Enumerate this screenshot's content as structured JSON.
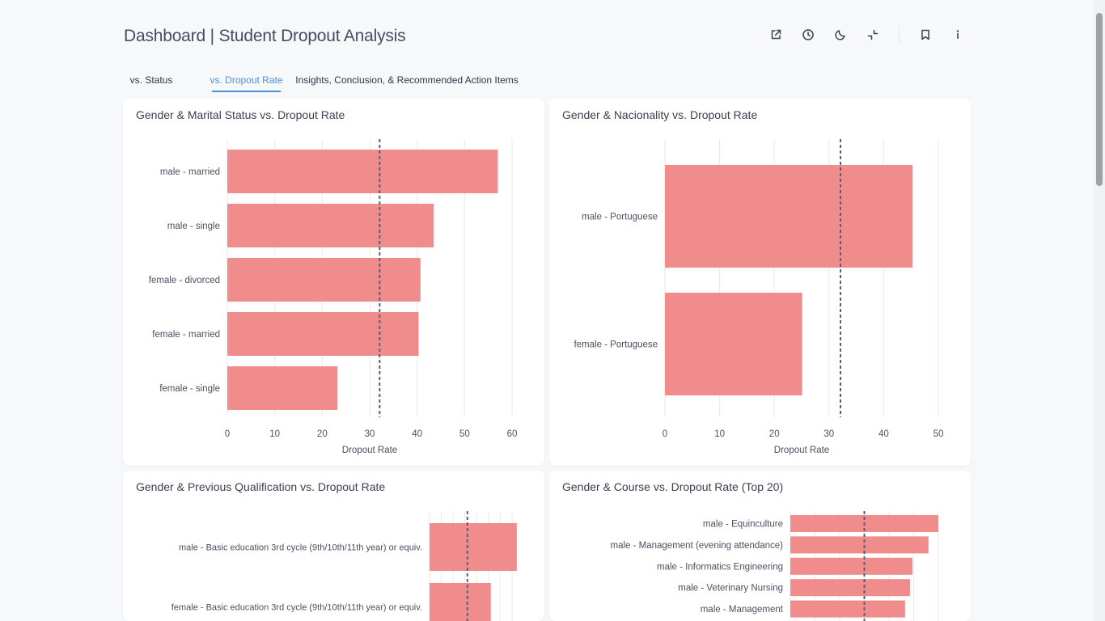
{
  "page": {
    "title": "Dashboard | Student Dropout Analysis"
  },
  "toolbar": {
    "icons": [
      "external-link-icon",
      "clock-icon",
      "moon-icon",
      "collapse-icon",
      "bookmark-icon",
      "info-icon"
    ]
  },
  "tabs": [
    {
      "label": "vs. Status",
      "active": false
    },
    {
      "label": "vs. Dropout Rate",
      "active": true
    },
    {
      "label": "Insights, Conclusion, & Recommended Action Items",
      "active": false
    }
  ],
  "colors": {
    "bar": "#f08c8c",
    "reference_line": "#5a6070",
    "accent": "#4a90e2"
  },
  "chart_data": [
    {
      "type": "bar",
      "orientation": "horizontal",
      "title": "Gender & Marital Status vs. Dropout Rate",
      "categories": [
        "male - married",
        "male - single",
        "female - divorced",
        "female - married",
        "female - single"
      ],
      "values": [
        57,
        43.5,
        40.7,
        40.3,
        23.2
      ],
      "xlabel": "Dropout Rate",
      "xlim": [
        0,
        60
      ],
      "xticks": [
        0,
        10,
        20,
        30,
        40,
        50,
        60
      ],
      "reference_line": 32.1,
      "grid": true
    },
    {
      "type": "bar",
      "orientation": "horizontal",
      "title": "Gender & Nacionality vs. Dropout Rate",
      "categories": [
        "male - Portuguese",
        "female - Portuguese"
      ],
      "values": [
        45.3,
        25.1
      ],
      "xlabel": "Dropout Rate",
      "xlim": [
        0,
        50
      ],
      "xticks": [
        0,
        10,
        20,
        30,
        40,
        50
      ],
      "reference_line": 32.1,
      "grid": true
    },
    {
      "type": "bar",
      "orientation": "horizontal",
      "title": "Gender & Previous Qualification vs. Dropout Rate",
      "categories": [
        "male - Basic education 3rd cycle (9th/10th/11th year) or equiv.",
        "female - Basic education 3rd cycle (9th/10th/11th year) or equiv."
      ],
      "values": [
        74,
        52
      ],
      "xlim": [
        0,
        70
      ],
      "reference_line": 32.1,
      "grid": true
    },
    {
      "type": "bar",
      "orientation": "horizontal",
      "title": "Gender & Course vs. Dropout Rate (Top 20)",
      "categories": [
        "male - Equinculture",
        "male - Management (evening attendance)",
        "male - Informatics Engineering",
        "male - Veterinary Nursing",
        "male - Management"
      ],
      "values": [
        60,
        56,
        49.5,
        48.5,
        46.5
      ],
      "xlim": [
        0,
        60
      ],
      "reference_line": 30,
      "grid": true
    }
  ]
}
